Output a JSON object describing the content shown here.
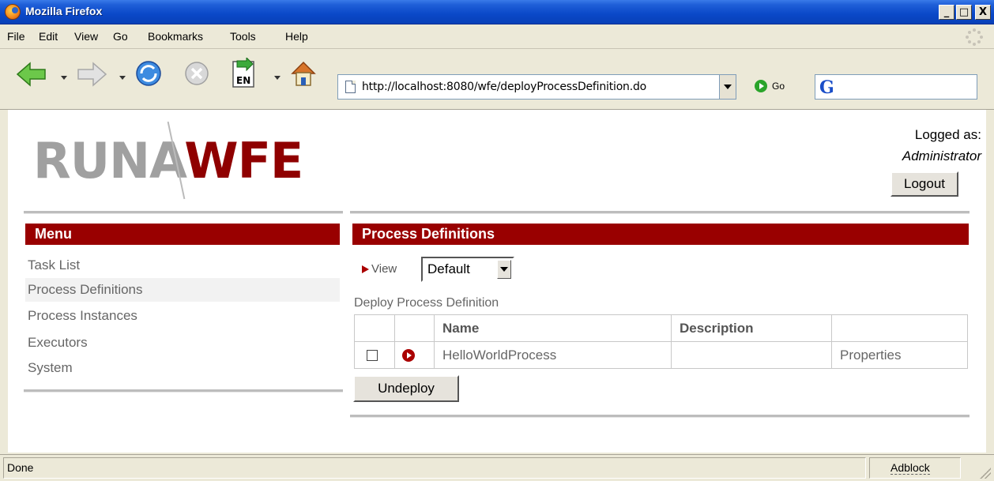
{
  "window": {
    "title": "Mozilla Firefox",
    "buttons": {
      "minimize": "_",
      "maximize": "□",
      "close": "X"
    }
  },
  "menubar": {
    "items": [
      "File",
      "Edit",
      "View",
      "Go",
      "Bookmarks",
      "Tools",
      "Help"
    ]
  },
  "navbar": {
    "url": "http://localhost:8080/wfe/deployProcessDefinition.do",
    "go_label": "Go",
    "search_engine": "G",
    "icons": [
      "back-icon",
      "forward-icon",
      "reload-icon",
      "stop-icon",
      "language-en-icon",
      "home-icon"
    ],
    "language_badge": "EN"
  },
  "header": {
    "logo_gray": "RUNA",
    "logo_red": "WFE",
    "logged_label": "Logged as:",
    "logged_user": "Administrator",
    "logout_label": "Logout"
  },
  "sidebar": {
    "title": "Menu",
    "items": [
      {
        "label": "Task List",
        "active": false
      },
      {
        "label": "Process Definitions",
        "active": true
      },
      {
        "label": "Process Instances",
        "active": false
      },
      {
        "label": "Executors",
        "active": false
      },
      {
        "label": "System",
        "active": false
      }
    ]
  },
  "main": {
    "title": "Process Definitions",
    "view_label": "View",
    "view_selected": "Default",
    "deploy_link": "Deploy Process Definition",
    "table": {
      "headers": [
        "",
        "",
        "Name",
        "Description",
        ""
      ],
      "rows": [
        {
          "name": "HelloWorldProcess",
          "description": "",
          "action": "Properties"
        }
      ]
    },
    "undeploy_label": "Undeploy"
  },
  "status": {
    "text": "Done",
    "adblock": "Adblock"
  },
  "colors": {
    "accent_red": "#990000",
    "titlebar_blue": "#0a48c8"
  }
}
